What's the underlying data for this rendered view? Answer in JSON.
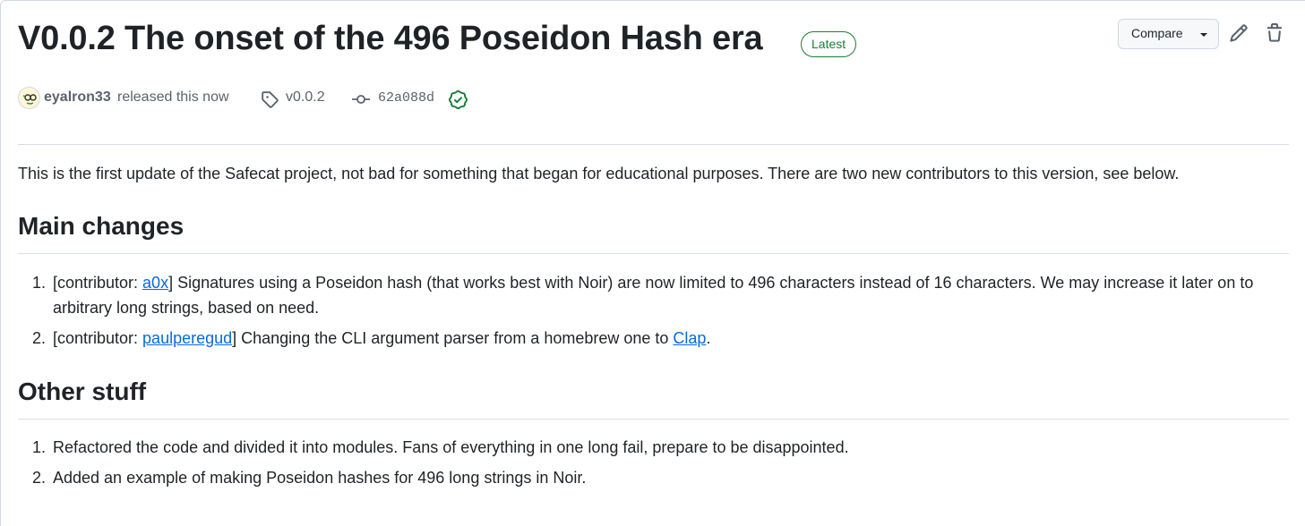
{
  "release": {
    "title": "V0.0.2 The onset of the 496 Poseidon Hash era",
    "badge": "Latest",
    "author": "eyalron33",
    "released_text": "released this now",
    "tag": "v0.0.2",
    "commit": "62a088d"
  },
  "header_actions": {
    "compare_label": "Compare"
  },
  "body": {
    "intro": "This is the first update of the Safecat project, not bad for something that began for educational purposes. There are two new contributors to this version, see below.",
    "main_changes": {
      "heading": "Main changes",
      "items": [
        {
          "num": "1.",
          "prefix": "[contributor: ",
          "link": "a0x",
          "text": "] Signatures using a Poseidon hash (that works best with Noir) are now limited to 496 characters instead of 16 characters. We may increase it later on to arbitrary long strings, based on need."
        },
        {
          "num": "2.",
          "prefix": "[contributor: ",
          "link": "paulperegud",
          "text": "] Changing the CLI argument parser from a homebrew one to ",
          "link2": "Clap",
          "suffix": "."
        }
      ]
    },
    "other_stuff": {
      "heading": "Other stuff",
      "items": [
        {
          "num": "1.",
          "text": "Refactored the code and divided it into modules. Fans of everything in one long fail, prepare to be disappointed."
        },
        {
          "num": "2.",
          "text": "Added an example of making Poseidon hashes for 496 long strings in Noir."
        }
      ]
    }
  },
  "colors": {
    "text": "#1f2328",
    "muted": "#59636e",
    "link": "#0969da",
    "success": "#1a7f37",
    "border": "#d0d7de"
  }
}
